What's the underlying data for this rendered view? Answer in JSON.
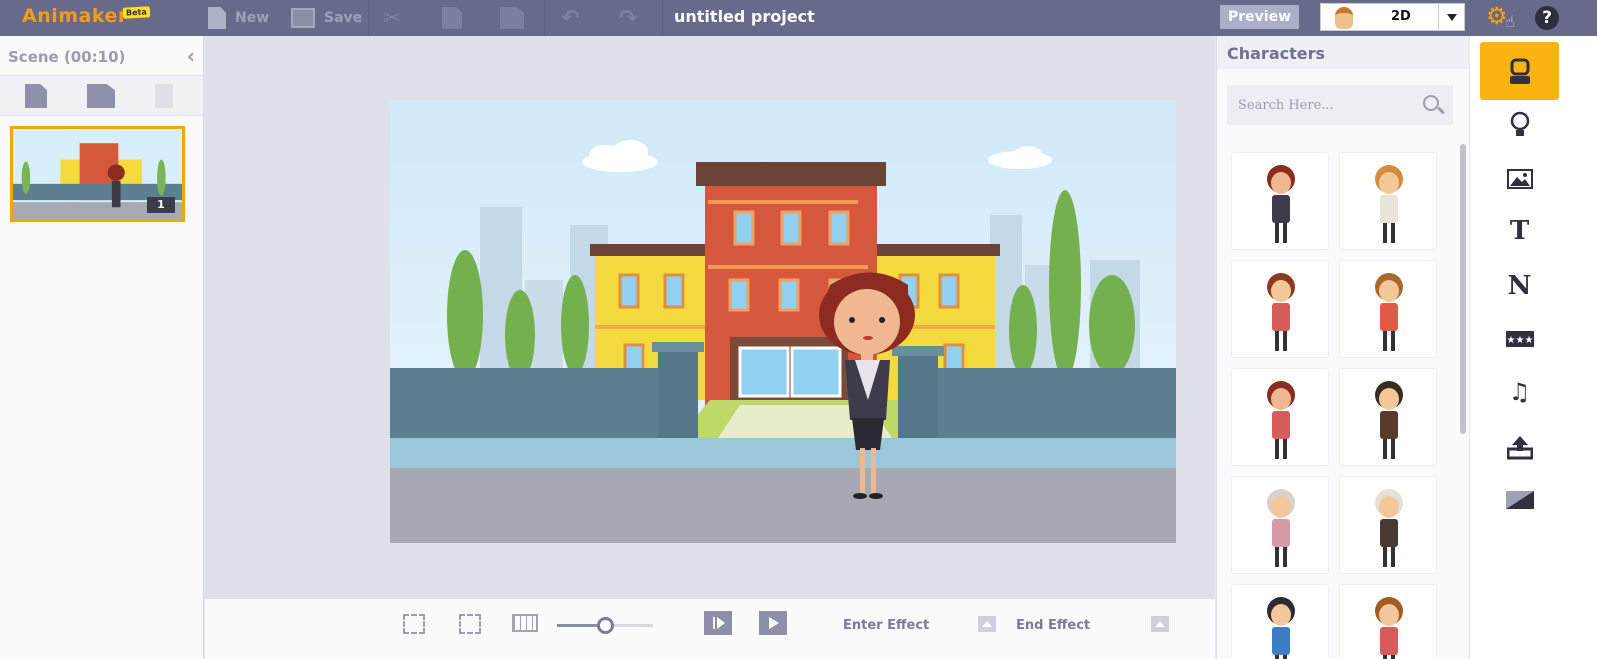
{
  "app": {
    "logo": "Animaker",
    "beta_badge": "Beta"
  },
  "toolbar": {
    "new_label": "New",
    "save_label": "Save",
    "project_title": "untitled project",
    "preview_label": "Preview",
    "mode_value": "2D"
  },
  "scene_panel": {
    "title": "Scene (00:10)",
    "thumbnail_number": "1"
  },
  "bottom_bar": {
    "enter_effect_label": "Enter Effect",
    "end_effect_label": "End Effect",
    "zoom_fraction": 0.5
  },
  "characters_panel": {
    "title": "Characters",
    "search_placeholder": "Search Here...",
    "items": [
      "woman-business-suit",
      "man-yellow-tie",
      "girl-headband",
      "boy-red-shirt",
      "woman-red-top",
      "man-brown-suit",
      "old-woman-cane",
      "old-man-cane",
      "boy-kid",
      "girl-pigtails"
    ]
  },
  "right_tools": [
    "character-tool",
    "idea-tool",
    "image-tool",
    "text-tool",
    "number-tool",
    "badge-tool",
    "music-tool",
    "upload-tool",
    "background-tool"
  ],
  "colors": {
    "accent": "#f6a400",
    "topbar": "#686a8c",
    "active_tool": "#fbb40f"
  }
}
